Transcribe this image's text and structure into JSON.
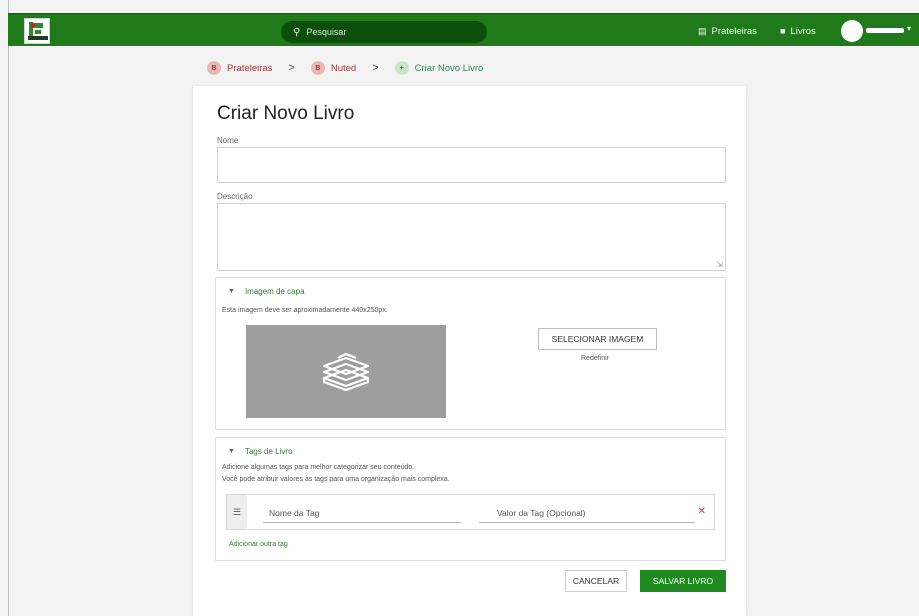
{
  "header": {
    "search_placeholder": "Pesquisar",
    "nav": [
      {
        "label": "Prateleiras",
        "icon": "shelves-icon"
      },
      {
        "label": "Livros",
        "icon": "books-icon"
      }
    ]
  },
  "breadcrumb": {
    "items": [
      {
        "badge": "B",
        "label": "Prateleiras"
      },
      {
        "badge": "B",
        "label": "Nuted"
      },
      {
        "badge": "+",
        "label": "Criar Novo Livro"
      }
    ],
    "separator": ">"
  },
  "form": {
    "title": "Criar Novo Livro",
    "name_label": "Nome",
    "name_value": "",
    "description_label": "Descrição",
    "description_value": "",
    "cover": {
      "heading": "Imagem de capa",
      "hint": "Esta imagem deve ser aproximadamente 440x250px.",
      "select_button": "SELECIONAR IMAGEM",
      "reset_link": "Redefinir"
    },
    "tags": {
      "heading": "Tags de Livro",
      "hint_line1": "Adicione algumas tags para melhor categorizar seu conteúdo.",
      "hint_line2": "Você pode atribuir valores às tags para uma organização mais complexa.",
      "tag_name_placeholder": "Nome da Tag",
      "tag_value_placeholder": "Valor da Tag (Opcional)",
      "add_link": "Adicionar outra tag"
    },
    "cancel_button": "CANCELAR",
    "save_button": "SALVAR LIVRO"
  },
  "colors": {
    "brand_green": "#1f7a1a",
    "accent_green": "#2e7d32",
    "danger": "#d32f2f"
  }
}
